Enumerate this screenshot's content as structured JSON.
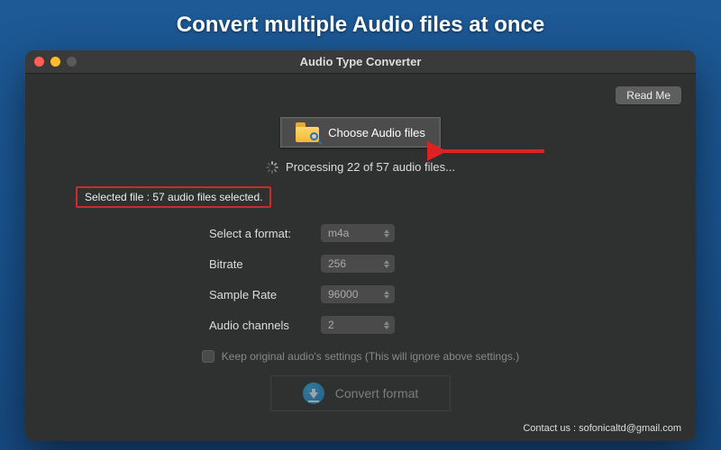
{
  "banner": "Convert multiple Audio files at once",
  "window": {
    "title": "Audio Type Converter",
    "readme_label": "Read Me",
    "choose_label": "Choose Audio files",
    "processing_text": "Processing 22 of 57 audio files...",
    "selected_text": "Selected file : 57 audio files selected.",
    "options": {
      "format_label": "Select a format:",
      "format_value": "m4a",
      "bitrate_label": "Bitrate",
      "bitrate_value": "256",
      "sample_label": "Sample Rate",
      "sample_value": "96000",
      "channels_label": "Audio channels",
      "channels_value": "2"
    },
    "keep_label": "Keep original audio's settings (This will ignore above settings.)",
    "convert_label": "Convert format",
    "contact_text": "Contact us : sofonicaltd@gmail.com"
  }
}
